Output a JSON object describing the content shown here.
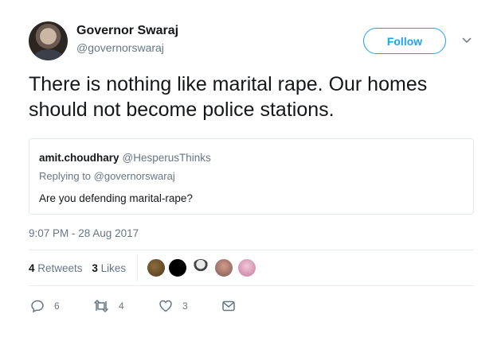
{
  "author": {
    "display_name": "Governor Swaraj",
    "handle": "@governorswaraj"
  },
  "follow_button": {
    "label": "Follow"
  },
  "tweet": {
    "text": "There is nothing like marital rape. Our homes should not become police stations.",
    "timestamp": "9:07 PM - 28 Aug 2017"
  },
  "quoted": {
    "display_name": "amit.choudhary",
    "handle": "@HesperusThinks",
    "replying_to": "Replying to @governorswaraj",
    "text": "Are you defending marital-rape?"
  },
  "stats": {
    "retweets_count": "4",
    "retweets_label": "Retweets",
    "likes_count": "3",
    "likes_label": "Likes"
  },
  "actions": {
    "reply_count": "6",
    "retweet_count": "4",
    "like_count": "3"
  },
  "colors": {
    "accent": "#1da1f2",
    "secondary_text": "#657786",
    "border": "#e1e8ed"
  },
  "icons": [
    "caret-down-icon",
    "reply-icon",
    "retweet-icon",
    "heart-icon",
    "direct-message-icon"
  ]
}
